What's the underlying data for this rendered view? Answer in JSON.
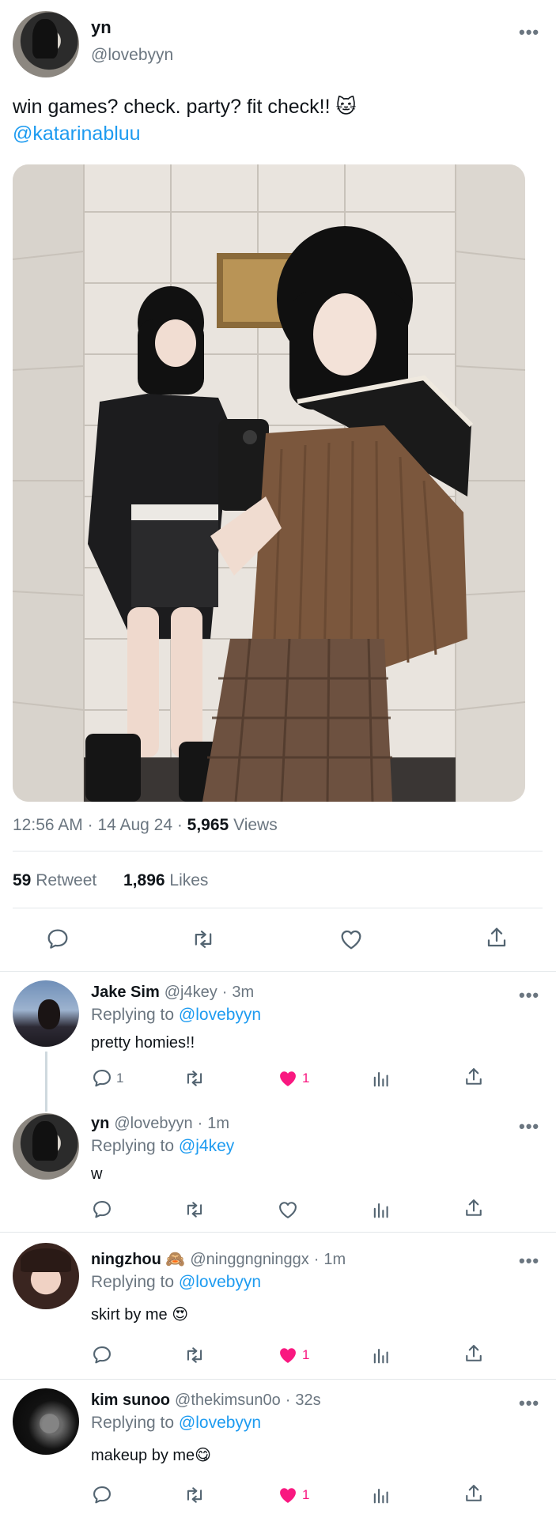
{
  "tweet": {
    "author_name": "yn",
    "author_handle": "@lovebyyn",
    "text": "win games? check. party? fit check!! 🐱",
    "mention": "@katarinabluu",
    "time": "12:56 AM",
    "date": "14 Aug 24",
    "views_count": "5,965",
    "views_label": "Views",
    "retweets_count": "59",
    "retweets_label": "Retweet",
    "likes_count": "1,896",
    "likes_label": "Likes",
    "more_label": "•••"
  },
  "replies": [
    {
      "name": "Jake Sim",
      "handle": "@j4key",
      "time": "3m",
      "replying_label": "Replying to",
      "replying_to": "@lovebyyn",
      "text": "pretty homies!!",
      "reply_count": "1",
      "like_count": "1",
      "liked": true
    },
    {
      "name": "yn",
      "handle": "@lovebyyn",
      "time": "1m",
      "replying_label": "Replying to",
      "replying_to": "@j4key",
      "text": "w",
      "reply_count": "",
      "like_count": "",
      "liked": false
    },
    {
      "name": "ningzhou 🙈",
      "handle": "@ninggngninggx",
      "time": "1m",
      "replying_label": "Replying to",
      "replying_to": "@lovebyyn",
      "text": "skirt by me 😍",
      "reply_count": "",
      "like_count": "1",
      "liked": true
    },
    {
      "name": "kim sunoo",
      "handle": "@thekimsun0o",
      "time": "32s",
      "replying_label": "Replying to",
      "replying_to": "@lovebyyn",
      "text": "makeup by me😋",
      "reply_count": "",
      "like_count": "1",
      "liked": true
    }
  ],
  "icons": {
    "reply": "speech-bubble-icon",
    "retweet": "retweet-arrows-icon",
    "like": "heart-icon",
    "views": "bar-chart-icon",
    "share": "share-arrow-icon",
    "more": "ellipsis-icon"
  },
  "colors": {
    "link": "#1d9bf0",
    "liked": "#f91880",
    "secondary_text": "#6b7680",
    "divider": "#e3e7ea"
  }
}
